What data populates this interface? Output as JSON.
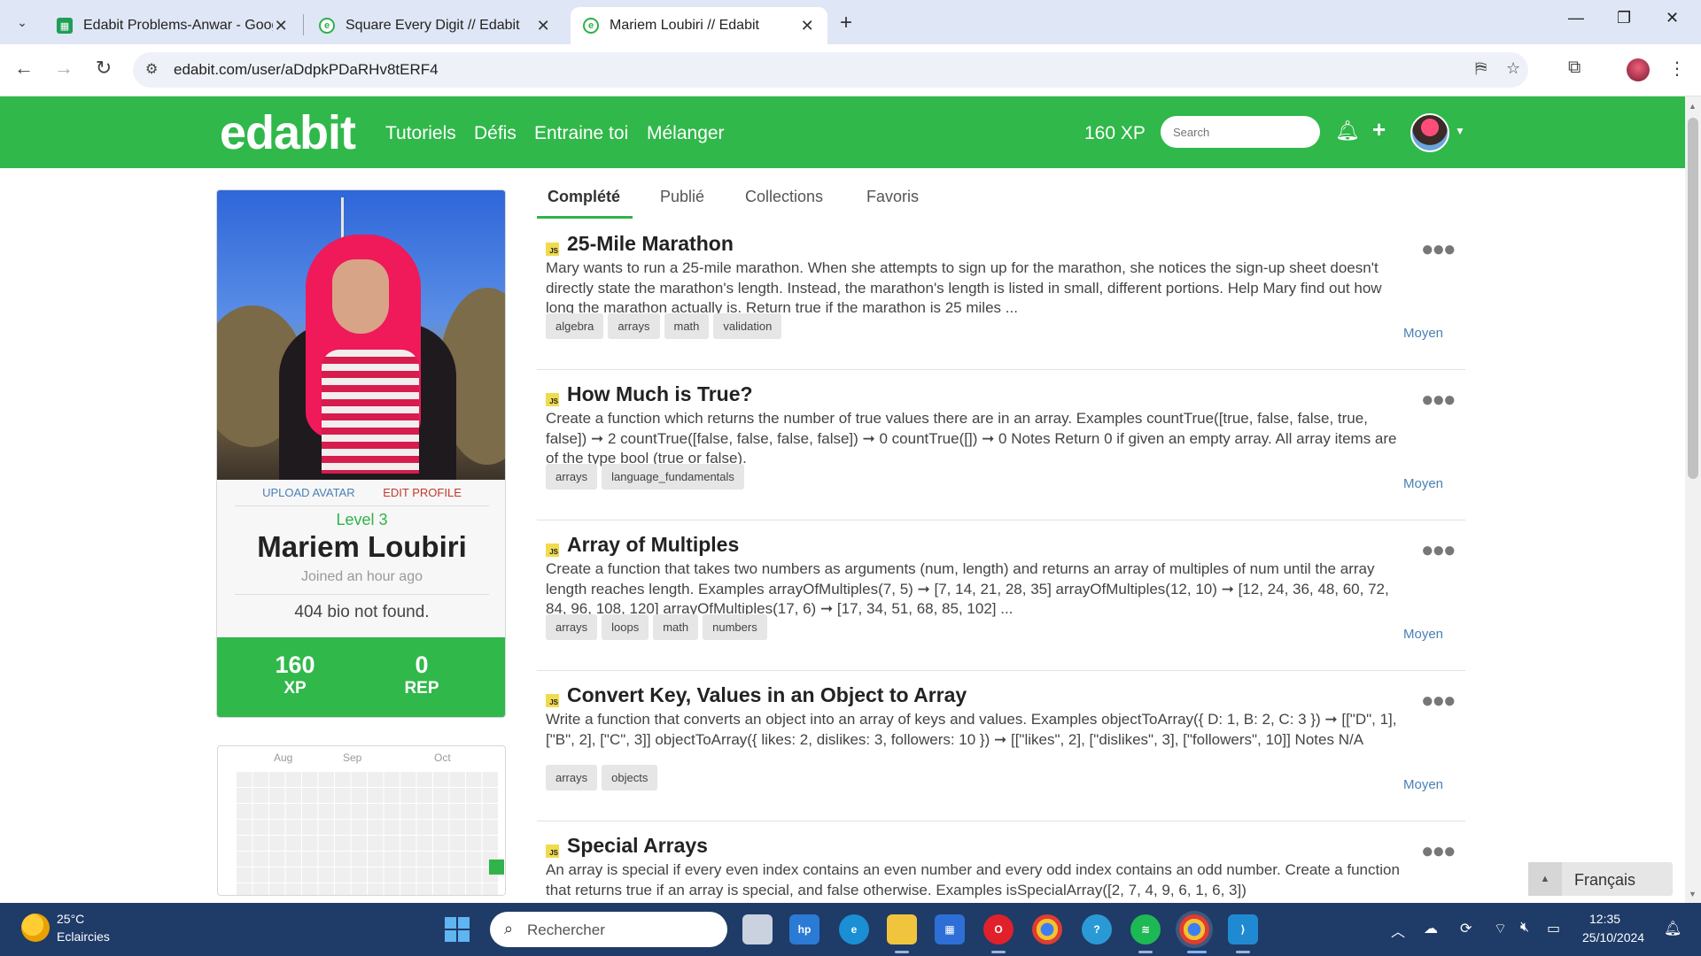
{
  "browser": {
    "tabs": [
      {
        "title": "Edabit Problems-Anwar - Goog",
        "favicon": "sheets-icon",
        "close": "✕"
      },
      {
        "title": "Square Every Digit // Edabit",
        "favicon": "edabit-icon",
        "close": "✕"
      },
      {
        "title": "Mariem Loubiri // Edabit",
        "favicon": "edabit-icon",
        "close": "✕"
      }
    ],
    "url": "edabit.com/user/aDdpkPDaRHv8tERF4"
  },
  "header": {
    "logo": "edabit",
    "nav": [
      "Tutoriels",
      "Défis",
      "Entraine toi",
      "Mélanger"
    ],
    "xp": "160 XP",
    "search_placeholder": "Search"
  },
  "profile": {
    "upload_avatar": "UPLOAD AVATAR",
    "edit_profile": "EDIT PROFILE",
    "level": "Level 3",
    "name": "Mariem Loubiri",
    "joined": "Joined an hour ago",
    "bio": "404 bio not found.",
    "xp_value": "160",
    "xp_label": "XP",
    "rep_value": "0",
    "rep_label": "REP"
  },
  "activity": {
    "months": [
      "Aug",
      "Sep",
      "Oct"
    ]
  },
  "profile_tabs": [
    "Complété",
    "Publié",
    "Collections",
    "Favoris"
  ],
  "challenges": [
    {
      "lang": "JS",
      "title": "25-Mile Marathon",
      "description": "Mary wants to run a 25-mile marathon. When she attempts to sign up for the marathon, she notices the sign-up sheet doesn't directly state the marathon's length. Instead, the marathon's length is listed in small, different portions. Help Mary find out how long the marathon actually is. Return true if the marathon is 25 miles ...",
      "tags": [
        "algebra",
        "arrays",
        "math",
        "validation"
      ],
      "difficulty": "Moyen"
    },
    {
      "lang": "JS",
      "title": "How Much is True?",
      "description": "Create a function which returns the number of true values there are in an array. Examples countTrue([true, false, false, true, false]) ➞ 2 countTrue([false, false, false, false]) ➞ 0 countTrue([]) ➞ 0 Notes Return 0 if given an empty array. All array items are of the type bool (true or false).",
      "tags": [
        "arrays",
        "language_fundamentals"
      ],
      "difficulty": "Moyen"
    },
    {
      "lang": "JS",
      "title": "Array of Multiples",
      "description": "Create a function that takes two numbers as arguments (num, length) and returns an array of multiples of num until the array length reaches length. Examples arrayOfMultiples(7, 5) ➞ [7, 14, 21, 28, 35] arrayOfMultiples(12, 10) ➞ [12, 24, 36, 48, 60, 72, 84, 96, 108, 120] arrayOfMultiples(17, 6) ➞ [17, 34, 51, 68, 85, 102] ...",
      "tags": [
        "arrays",
        "loops",
        "math",
        "numbers"
      ],
      "difficulty": "Moyen"
    },
    {
      "lang": "JS",
      "title": "Convert Key, Values in an Object to Array",
      "description": "Write a function that converts an object into an array of keys and values. Examples objectToArray({ D: 1, B: 2, C: 3 }) ➞ [[\"D\", 1], [\"B\", 2], [\"C\", 3]] objectToArray({ likes: 2, dislikes: 3, followers: 10 }) ➞ [[\"likes\", 2], [\"dislikes\", 3], [\"followers\", 10]] Notes N/A",
      "tags": [
        "arrays",
        "objects"
      ],
      "difficulty": "Moyen"
    },
    {
      "lang": "JS",
      "title": "Special Arrays",
      "description": "An array is special if every even index contains an even number and every odd index contains an odd number. Create a function that returns true if an array is special, and false otherwise. Examples isSpecialArray([2, 7, 4, 9, 6, 1, 6, 3])",
      "tags": [],
      "difficulty": ""
    }
  ],
  "language_picker": "Français",
  "taskbar": {
    "temperature": "25°C",
    "weather": "Eclaircies",
    "search": "Rechercher",
    "time": "12:35",
    "date": "25/10/2024"
  },
  "colors": {
    "brand_green": "#30b84a",
    "link_blue": "#4a7fb5",
    "edit_red": "#c0392b",
    "taskbar": "#1f3b68"
  }
}
